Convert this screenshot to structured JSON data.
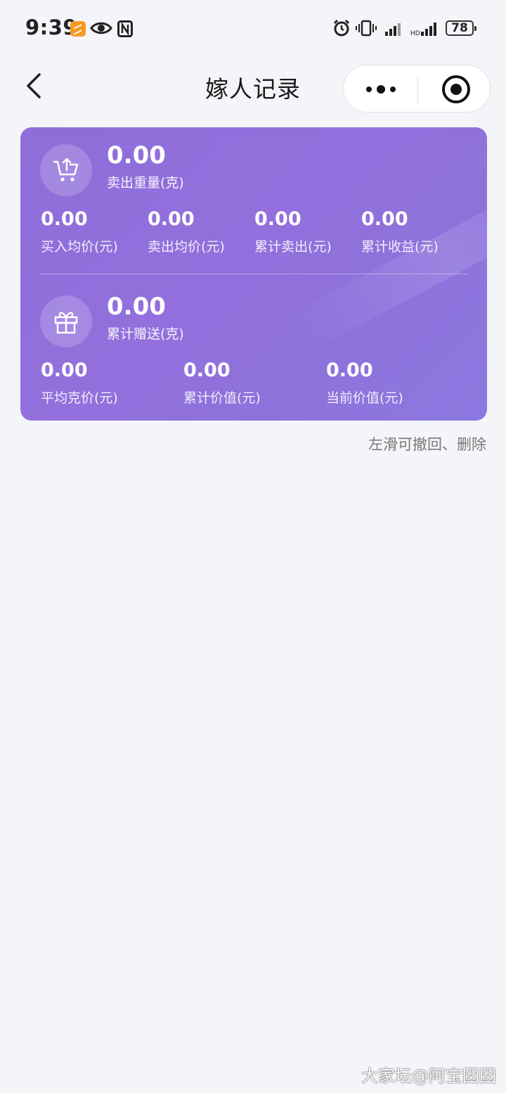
{
  "status_bar": {
    "time": "9:39",
    "battery": "78",
    "icons": [
      "app-badge-icon",
      "eye-icon",
      "nfc-icon",
      "alarm-icon",
      "vibrate-icon",
      "signal-icon",
      "signal-icon",
      "battery-icon"
    ]
  },
  "nav": {
    "title": "嫁人记录",
    "back_icon": "chevron-left-icon",
    "more_icon": "more-dots-icon",
    "close_icon": "target-icon"
  },
  "summary": {
    "sell": {
      "icon": "cart-upload-icon",
      "value": "0.00",
      "label": "卖出重量(克)",
      "stats": [
        {
          "value": "0.00",
          "label": "买入均价(元)"
        },
        {
          "value": "0.00",
          "label": "卖出均价(元)"
        },
        {
          "value": "0.00",
          "label": "累计卖出(元)"
        },
        {
          "value": "0.00",
          "label": "累计收益(元)"
        }
      ]
    },
    "gift": {
      "icon": "gift-icon",
      "value": "0.00",
      "label": "累计赠送(克)",
      "stats": [
        {
          "value": "0.00",
          "label": "平均克价(元)"
        },
        {
          "value": "0.00",
          "label": "累计价值(元)"
        },
        {
          "value": "0.00",
          "label": "当前价值(元)"
        }
      ]
    }
  },
  "hint": "左滑可撤回、删除",
  "watermark": "大家坛@阿宝囡囡",
  "colors": {
    "card": "#9370dd",
    "background": "#f4f5f9"
  }
}
